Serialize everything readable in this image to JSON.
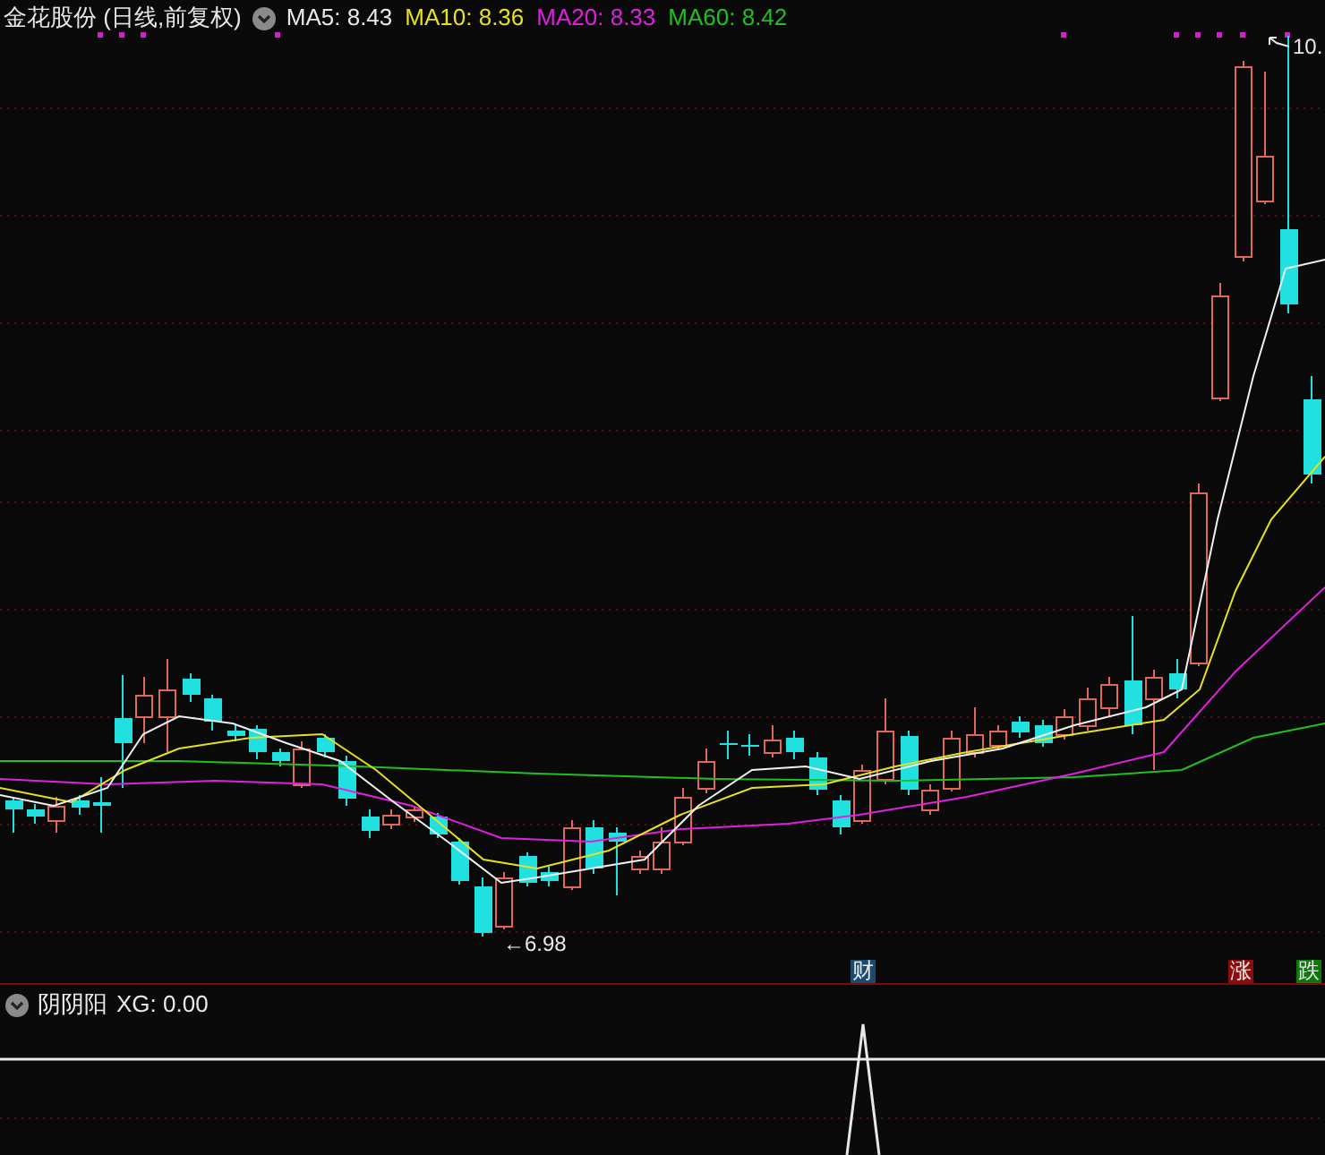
{
  "header": {
    "title": "金花股份 (日线,前复权)",
    "indicators": [
      {
        "label": "MA5: 8.43",
        "color": "#e8e8e8"
      },
      {
        "label": "MA10: 8.36",
        "color": "#e6e020"
      },
      {
        "label": "MA20: 8.33",
        "color": "#e020e0"
      },
      {
        "label": "MA60: 8.42",
        "color": "#20c020"
      }
    ]
  },
  "price_labels": {
    "high": "10.",
    "low": "←6.98"
  },
  "event_markers": [
    {
      "text": "财",
      "color": "#1a4a70"
    },
    {
      "text": "涨",
      "color": "#8a0c0c"
    },
    {
      "text": "跌",
      "color": "#0c780c"
    }
  ],
  "sub_panel": {
    "title": "阴阴阳",
    "indicator": "XG: 0.00"
  }
}
